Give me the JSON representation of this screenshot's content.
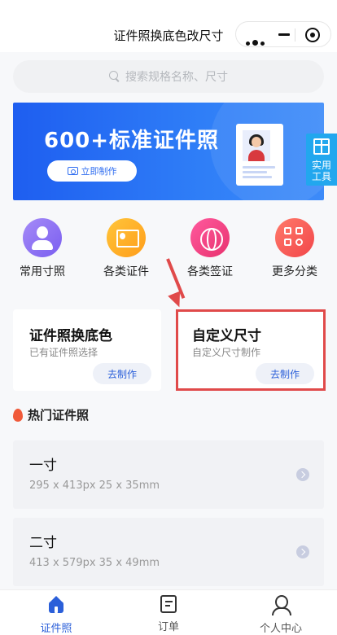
{
  "header": {
    "title": "证件照换底色改尺寸"
  },
  "search": {
    "placeholder": "搜索规格名称、尺寸"
  },
  "banner": {
    "title": "600+标准证件照",
    "button_label": "立即制作"
  },
  "tools_tag": {
    "line1": "实用",
    "line2": "工具"
  },
  "categories": [
    {
      "label": "常用寸照"
    },
    {
      "label": "各类证件"
    },
    {
      "label": "各类签证"
    },
    {
      "label": "更多分类"
    }
  ],
  "cards": [
    {
      "title": "证件照换底色",
      "subtitle": "已有证件照选择",
      "button": "去制作"
    },
    {
      "title": "自定义尺寸",
      "subtitle": "自定义尺寸制作",
      "button": "去制作"
    }
  ],
  "hot": {
    "title": "热门证件照",
    "items": [
      {
        "name": "一寸",
        "dims": "295 x 413px  25 x 35mm"
      },
      {
        "name": "二寸",
        "dims": "413 x 579px  35 x 49mm"
      }
    ]
  },
  "tabbar": {
    "items": [
      {
        "label": "证件照"
      },
      {
        "label": "订单"
      },
      {
        "label": "个人中心"
      }
    ]
  },
  "colors": {
    "accent": "#2b5fd9",
    "banner": "#1e5ef0",
    "highlight": "#e04a4a",
    "tools_tag": "#22a7ee"
  },
  "icons": [
    "more-icon",
    "minimize-icon",
    "target-icon",
    "search-icon",
    "camera-icon",
    "gift-icon",
    "person-icon",
    "id-card-icon",
    "globe-icon",
    "grid-icon",
    "flame-icon",
    "chevron-right-icon",
    "home-icon",
    "order-icon",
    "user-icon"
  ]
}
